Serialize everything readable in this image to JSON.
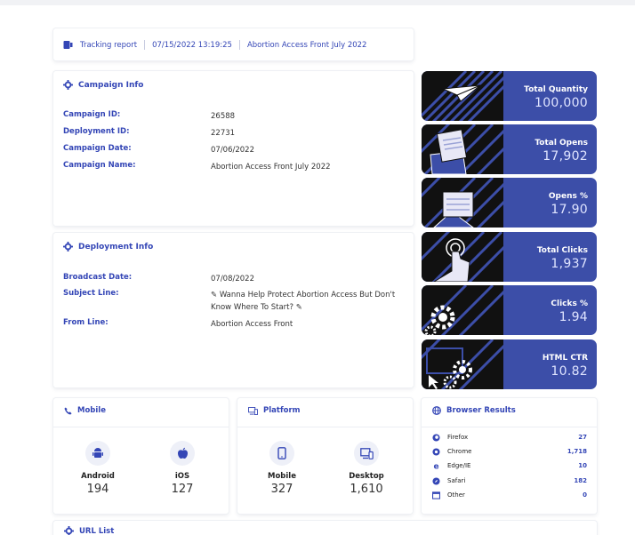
{
  "report_bar": {
    "label": "Tracking report",
    "timestamp": "07/15/2022 13:19:25",
    "campaign_title": "Abortion Access Front July 2022"
  },
  "campaign_info": {
    "title": "Campaign Info",
    "rows": [
      {
        "key": "Campaign ID:",
        "value": "26588"
      },
      {
        "key": "Deployment ID:",
        "value": "22731"
      },
      {
        "key": "Campaign Date:",
        "value": "07/06/2022"
      },
      {
        "key": "Campaign Name:",
        "value": "Abortion Access Front July 2022"
      }
    ]
  },
  "deployment_info": {
    "title": "Deployment Info",
    "rows": [
      {
        "key": "Broadcast Date:",
        "value": "07/08/2022"
      },
      {
        "key": "Subject Line:",
        "value": "✎ Wanna Help Protect Abortion Access But Don't Know Where To Start? ✎"
      },
      {
        "key": "From Line:",
        "value": "Abortion Access Front"
      }
    ]
  },
  "stats": [
    {
      "label": "Total Quantity",
      "value": "100,000",
      "icon": "paper-plane-icon"
    },
    {
      "label": "Total Opens",
      "value": "17,902",
      "icon": "envelope-open-icon"
    },
    {
      "label": "Opens %",
      "value": "17.90",
      "icon": "envelope-letter-icon"
    },
    {
      "label": "Total Clicks",
      "value": "1,937",
      "icon": "hand-pointer-icon"
    },
    {
      "label": "Clicks %",
      "value": "1.94",
      "icon": "gears-icon"
    },
    {
      "label": "HTML CTR",
      "value": "10.82",
      "icon": "gears-cursor-icon"
    }
  ],
  "mobile": {
    "title": "Mobile",
    "items": [
      {
        "name": "Android",
        "value": "194",
        "icon": "android-icon"
      },
      {
        "name": "iOS",
        "value": "127",
        "icon": "apple-icon"
      }
    ]
  },
  "platform": {
    "title": "Platform",
    "items": [
      {
        "name": "Mobile",
        "value": "327",
        "icon": "mobile-phone-icon"
      },
      {
        "name": "Desktop",
        "value": "1,610",
        "icon": "desktop-icon"
      }
    ]
  },
  "browser_results": {
    "title": "Browser Results",
    "rows": [
      {
        "name": "Firefox",
        "value": "27",
        "icon": "firefox-icon"
      },
      {
        "name": "Chrome",
        "value": "1,718",
        "icon": "chrome-icon"
      },
      {
        "name": "Edge/IE",
        "value": "10",
        "icon": "edge-icon"
      },
      {
        "name": "Safari",
        "value": "182",
        "icon": "safari-icon"
      },
      {
        "name": "Other",
        "value": "0",
        "icon": "browser-window-icon"
      }
    ]
  },
  "url_list": {
    "title": "URL List"
  },
  "colors": {
    "accent": "#3446b6",
    "tile_bg": "#3c4ea8",
    "page_bg": "#ffffff"
  }
}
